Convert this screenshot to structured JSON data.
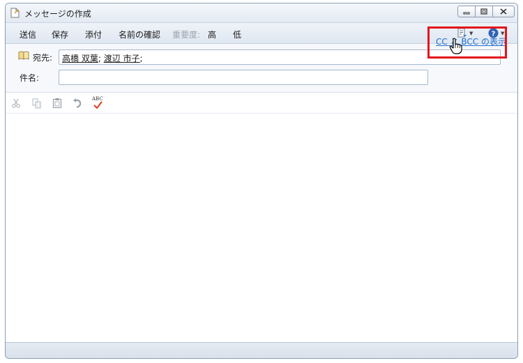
{
  "window": {
    "title": "メッセージの作成"
  },
  "toolbar": {
    "send": "送信",
    "save": "保存",
    "attach": "添付",
    "check_names": "名前の確認",
    "importance_label": "重要度:",
    "high": "高",
    "low": "低",
    "options_icon": "document-options-icon",
    "help_icon": "help-icon"
  },
  "header": {
    "to_label": "宛先:",
    "to_recipients": [
      "高橋 双葉",
      "渡辺 市子"
    ],
    "separator": ";",
    "subject_label": "件名:",
    "subject_value": "",
    "show_cc_bcc": "CC と BCC の表示"
  },
  "format_bar": {
    "icons": [
      "cut-icon",
      "copy-icon",
      "paste-icon",
      "undo-icon",
      "spellcheck-icon"
    ],
    "spellcheck_text": "ABC"
  },
  "colors": {
    "highlight": "#e3141c",
    "link": "#1f6fcf",
    "disabled": "#9aa3ad"
  }
}
